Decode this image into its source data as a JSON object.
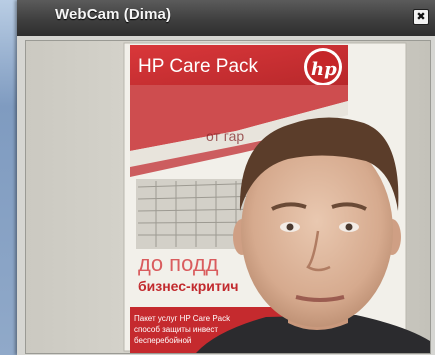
{
  "window": {
    "title": "WebCam (Dima)",
    "close_icon": "close-icon"
  },
  "feed": {
    "poster": {
      "brand_heading": "HP Care Pack",
      "logo_text": "hp",
      "line_partial": "от гар",
      "headline_partial": "до подд",
      "subheadline_partial": "бизнес-критич",
      "footer_line1": "Пакет услуг HP Care Pack",
      "footer_line2": "способ защиты инвест",
      "footer_line3": "бесперебойной"
    },
    "colors": {
      "hp_red": "#d02a2e",
      "wall": "#d8d6cf"
    }
  }
}
